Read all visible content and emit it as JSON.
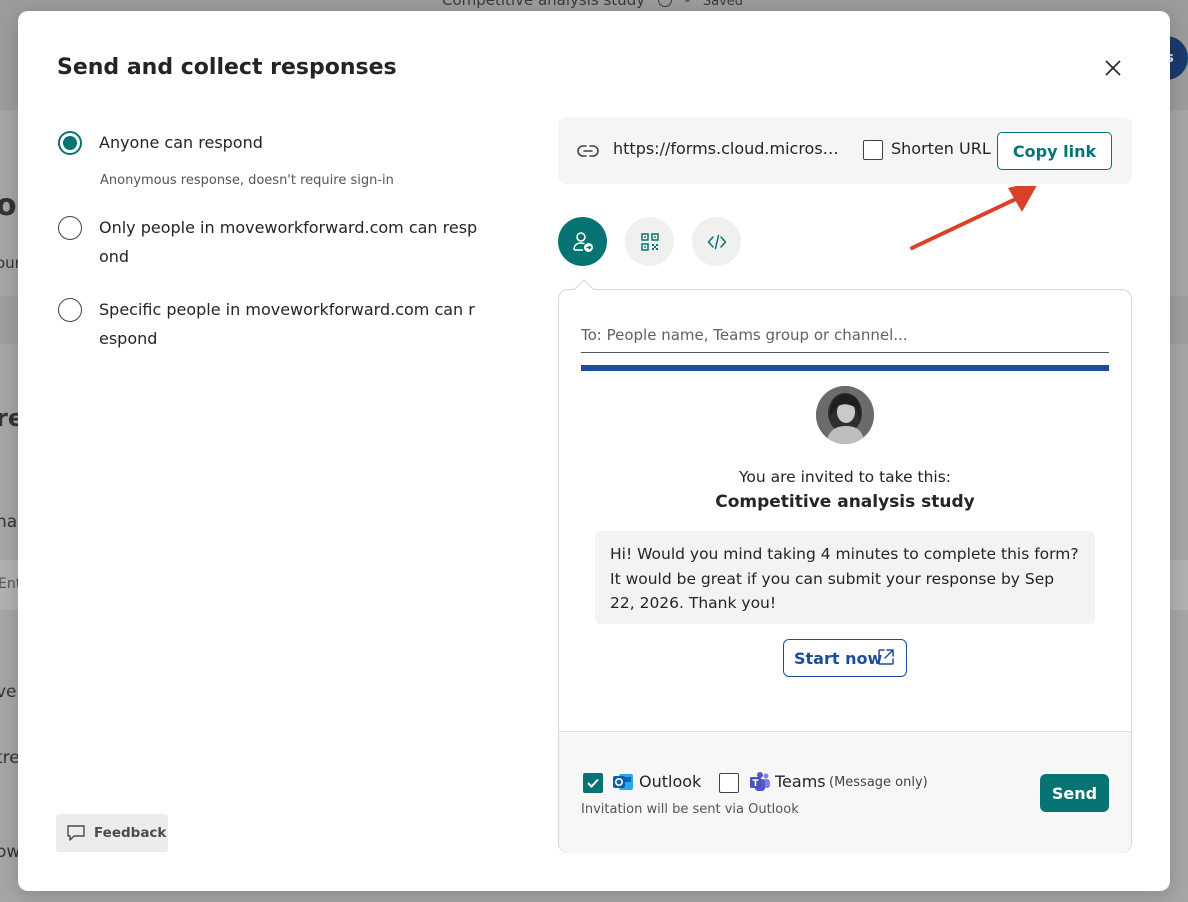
{
  "background": {
    "doc_title": "Competitive analysis study",
    "save_status": "Saved",
    "avatar_initials": "es",
    "fragments": [
      "on",
      "our",
      "re",
      "ha",
      "Ent",
      "ve",
      "tre",
      "ow"
    ]
  },
  "modal": {
    "title": "Send and collect responses",
    "options": [
      {
        "label": "Anyone can respond",
        "sublabel": "Anonymous response, doesn't require sign-in",
        "selected": true
      },
      {
        "label": "Only people in moveworkforward.com can respond",
        "selected": false
      },
      {
        "label": "Specific people in moveworkforward.com can respond",
        "selected": false
      }
    ],
    "feedback_label": "Feedback"
  },
  "link": {
    "url": "https://forms.cloud.microsoft...",
    "shorten_label": "Shorten URL",
    "shorten_checked": false,
    "copy_label": "Copy link"
  },
  "share_tabs": [
    {
      "icon": "invite-people-icon",
      "active": true
    },
    {
      "icon": "qr-code-icon",
      "active": false
    },
    {
      "icon": "embed-code-icon",
      "active": false
    }
  ],
  "invite": {
    "to_placeholder": "To: People name, Teams group or channel...",
    "invited_text": "You are invited to take this:",
    "form_name": "Competitive analysis study",
    "message": "Hi! Would you mind taking 4 minutes to complete this form? It would be great if you can submit your response by Sep 22, 2026. Thank you!",
    "start_label": "Start now",
    "channels": [
      {
        "name": "Outlook",
        "checked": true
      },
      {
        "name": "Teams",
        "note": "(Message only)",
        "checked": false
      }
    ],
    "via_text": "Invitation will be sent via Outlook",
    "send_label": "Send"
  },
  "colors": {
    "accent": "#077372",
    "brand_blue": "#1b4d9c",
    "annotation_arrow": "#d9412b"
  }
}
